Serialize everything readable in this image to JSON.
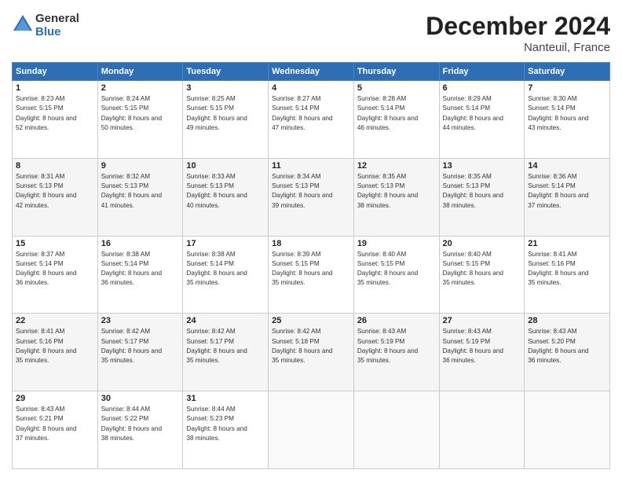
{
  "logo": {
    "line1": "General",
    "line2": "Blue"
  },
  "title": "December 2024",
  "location": "Nanteuil, France",
  "headers": [
    "Sunday",
    "Monday",
    "Tuesday",
    "Wednesday",
    "Thursday",
    "Friday",
    "Saturday"
  ],
  "weeks": [
    [
      {
        "day": "1",
        "sunrise": "8:23 AM",
        "sunset": "5:15 PM",
        "daylight": "8 hours and 52 minutes."
      },
      {
        "day": "2",
        "sunrise": "8:24 AM",
        "sunset": "5:15 PM",
        "daylight": "8 hours and 50 minutes."
      },
      {
        "day": "3",
        "sunrise": "8:25 AM",
        "sunset": "5:15 PM",
        "daylight": "8 hours and 49 minutes."
      },
      {
        "day": "4",
        "sunrise": "8:27 AM",
        "sunset": "5:14 PM",
        "daylight": "8 hours and 47 minutes."
      },
      {
        "day": "5",
        "sunrise": "8:28 AM",
        "sunset": "5:14 PM",
        "daylight": "8 hours and 46 minutes."
      },
      {
        "day": "6",
        "sunrise": "8:29 AM",
        "sunset": "5:14 PM",
        "daylight": "8 hours and 44 minutes."
      },
      {
        "day": "7",
        "sunrise": "8:30 AM",
        "sunset": "5:14 PM",
        "daylight": "8 hours and 43 minutes."
      }
    ],
    [
      {
        "day": "8",
        "sunrise": "8:31 AM",
        "sunset": "5:13 PM",
        "daylight": "8 hours and 42 minutes."
      },
      {
        "day": "9",
        "sunrise": "8:32 AM",
        "sunset": "5:13 PM",
        "daylight": "8 hours and 41 minutes."
      },
      {
        "day": "10",
        "sunrise": "8:33 AM",
        "sunset": "5:13 PM",
        "daylight": "8 hours and 40 minutes."
      },
      {
        "day": "11",
        "sunrise": "8:34 AM",
        "sunset": "5:13 PM",
        "daylight": "8 hours and 39 minutes."
      },
      {
        "day": "12",
        "sunrise": "8:35 AM",
        "sunset": "5:13 PM",
        "daylight": "8 hours and 38 minutes."
      },
      {
        "day": "13",
        "sunrise": "8:35 AM",
        "sunset": "5:13 PM",
        "daylight": "8 hours and 38 minutes."
      },
      {
        "day": "14",
        "sunrise": "8:36 AM",
        "sunset": "5:14 PM",
        "daylight": "8 hours and 37 minutes."
      }
    ],
    [
      {
        "day": "15",
        "sunrise": "8:37 AM",
        "sunset": "5:14 PM",
        "daylight": "8 hours and 36 minutes."
      },
      {
        "day": "16",
        "sunrise": "8:38 AM",
        "sunset": "5:14 PM",
        "daylight": "8 hours and 36 minutes."
      },
      {
        "day": "17",
        "sunrise": "8:38 AM",
        "sunset": "5:14 PM",
        "daylight": "8 hours and 35 minutes."
      },
      {
        "day": "18",
        "sunrise": "8:39 AM",
        "sunset": "5:15 PM",
        "daylight": "8 hours and 35 minutes."
      },
      {
        "day": "19",
        "sunrise": "8:40 AM",
        "sunset": "5:15 PM",
        "daylight": "8 hours and 35 minutes."
      },
      {
        "day": "20",
        "sunrise": "8:40 AM",
        "sunset": "5:15 PM",
        "daylight": "8 hours and 35 minutes."
      },
      {
        "day": "21",
        "sunrise": "8:41 AM",
        "sunset": "5:16 PM",
        "daylight": "8 hours and 35 minutes."
      }
    ],
    [
      {
        "day": "22",
        "sunrise": "8:41 AM",
        "sunset": "5:16 PM",
        "daylight": "8 hours and 35 minutes."
      },
      {
        "day": "23",
        "sunrise": "8:42 AM",
        "sunset": "5:17 PM",
        "daylight": "8 hours and 35 minutes."
      },
      {
        "day": "24",
        "sunrise": "8:42 AM",
        "sunset": "5:17 PM",
        "daylight": "8 hours and 35 minutes."
      },
      {
        "day": "25",
        "sunrise": "8:42 AM",
        "sunset": "5:18 PM",
        "daylight": "8 hours and 35 minutes."
      },
      {
        "day": "26",
        "sunrise": "8:43 AM",
        "sunset": "5:19 PM",
        "daylight": "8 hours and 35 minutes."
      },
      {
        "day": "27",
        "sunrise": "8:43 AM",
        "sunset": "5:19 PM",
        "daylight": "8 hours and 36 minutes."
      },
      {
        "day": "28",
        "sunrise": "8:43 AM",
        "sunset": "5:20 PM",
        "daylight": "8 hours and 36 minutes."
      }
    ],
    [
      {
        "day": "29",
        "sunrise": "8:43 AM",
        "sunset": "5:21 PM",
        "daylight": "8 hours and 37 minutes."
      },
      {
        "day": "30",
        "sunrise": "8:44 AM",
        "sunset": "5:22 PM",
        "daylight": "8 hours and 38 minutes."
      },
      {
        "day": "31",
        "sunrise": "8:44 AM",
        "sunset": "5:23 PM",
        "daylight": "8 hours and 38 minutes."
      },
      null,
      null,
      null,
      null
    ]
  ],
  "labels": {
    "sunrise": "Sunrise:",
    "sunset": "Sunset:",
    "daylight": "Daylight:"
  }
}
